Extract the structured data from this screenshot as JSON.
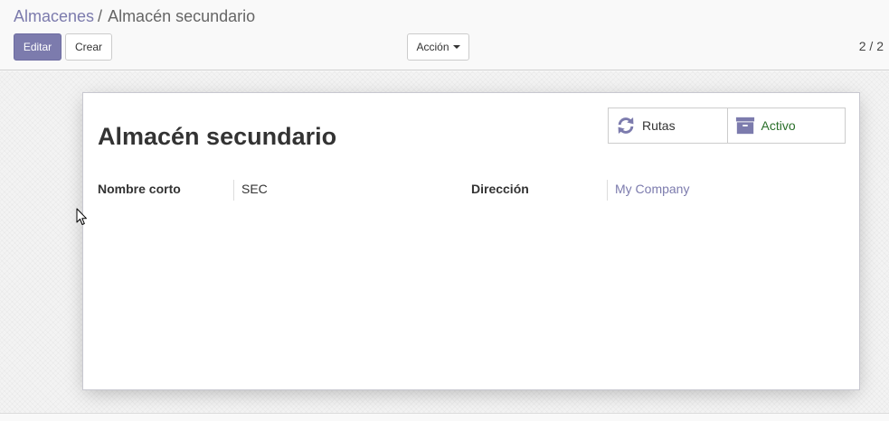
{
  "breadcrumb": {
    "parent": "Almacenes",
    "separator": "/",
    "current": "Almacén secundario"
  },
  "toolbar": {
    "edit_label": "Editar",
    "create_label": "Crear",
    "action_label": "Acción"
  },
  "pager": {
    "text": "2 / 2"
  },
  "record": {
    "name": "Almacén secundario",
    "smart_buttons": [
      {
        "label": "Rutas",
        "icon": "refresh-icon"
      },
      {
        "label": "Activo",
        "icon": "archive-icon"
      }
    ],
    "fields": {
      "short_name_label": "Nombre corto",
      "short_name_value": "SEC",
      "address_label": "Dirección",
      "address_value": "My Company"
    }
  },
  "colors": {
    "accent": "#7c7bad",
    "active": "#2a6f2a"
  }
}
